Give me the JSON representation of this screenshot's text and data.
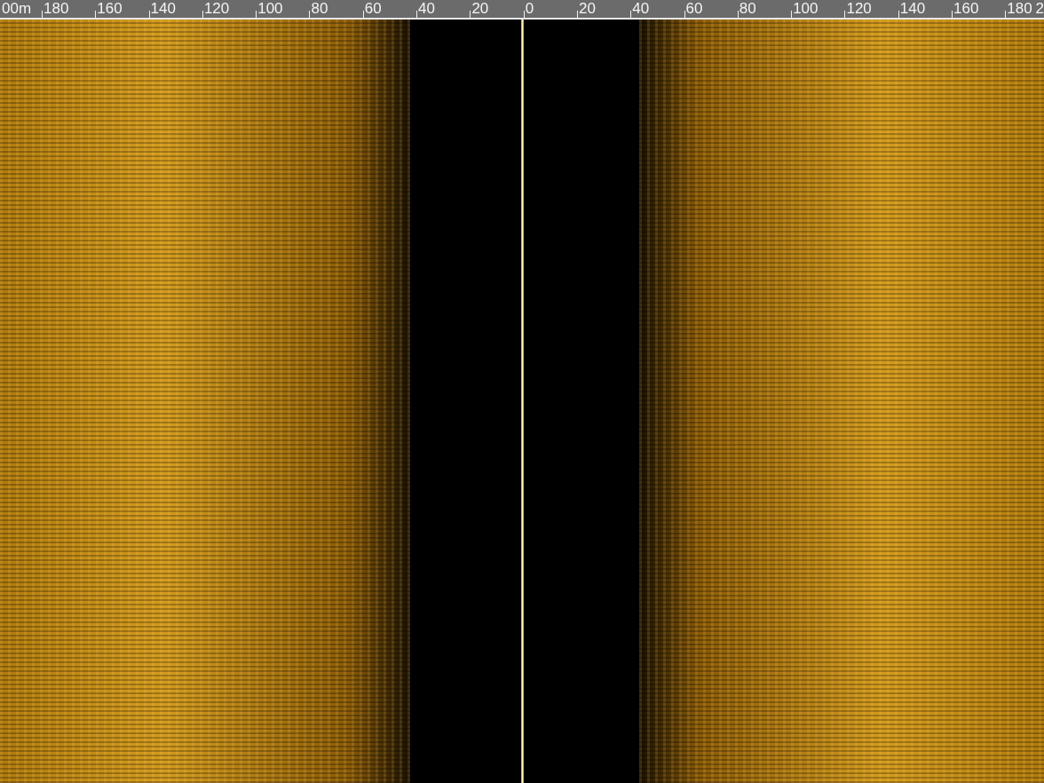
{
  "ruler": {
    "unit_label": "00m",
    "labels": [
      "180",
      "160",
      "140",
      "120",
      "100",
      "80",
      "60",
      "40",
      "20",
      "0",
      "20",
      "40",
      "60",
      "80",
      "100",
      "120",
      "140",
      "160",
      "180"
    ],
    "edge_label": "2"
  }
}
